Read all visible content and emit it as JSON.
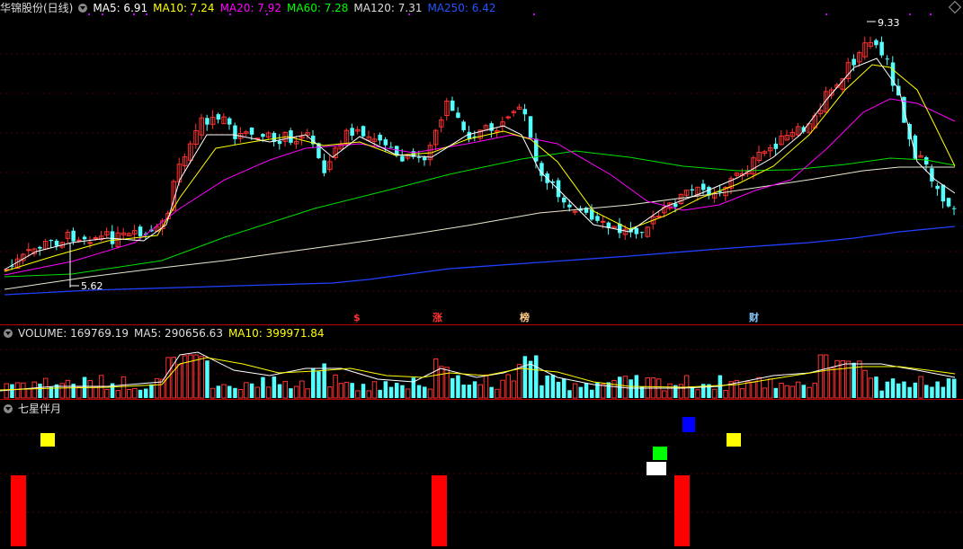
{
  "main_header": {
    "title": "华锦股份(日线)",
    "ma5": "MA5: 6.91",
    "ma10": "MA10: 7.24",
    "ma20": "MA20: 7.92",
    "ma60": "MA60: 7.28",
    "ma120": "MA120: 7.31",
    "ma250": "MA250: 6.42"
  },
  "price_marks": {
    "high": "9.33",
    "low": "5.62"
  },
  "event_tags": [
    "$",
    "涨",
    "榜",
    "财"
  ],
  "volume_header": {
    "volume": "VOLUME: 169769.19",
    "ma5": "MA5: 290656.63",
    "ma10": "MA10: 399971.84"
  },
  "indicator_header": {
    "title": "七星伴月"
  },
  "colors": {
    "up": "#ff3232",
    "down": "#54ffff",
    "ma5": "#ffffff",
    "ma10": "#ffff00",
    "ma20": "#ff00ff",
    "ma60": "#00ff00",
    "ma120": "#ffffc0",
    "ma250": "#0000ff"
  },
  "chart_data": {
    "type": "candlestick",
    "series": [
      {
        "name": "MA5",
        "last": 6.91
      },
      {
        "name": "MA10",
        "last": 7.24
      },
      {
        "name": "MA20",
        "last": 7.92
      },
      {
        "name": "MA60",
        "last": 7.28
      },
      {
        "name": "MA120",
        "last": 7.31
      },
      {
        "name": "MA250",
        "last": 6.42
      }
    ],
    "high": 9.33,
    "low": 5.62,
    "volume": {
      "last": 169769.19,
      "ma5": 290656.63,
      "ma10": 399971.84
    }
  }
}
